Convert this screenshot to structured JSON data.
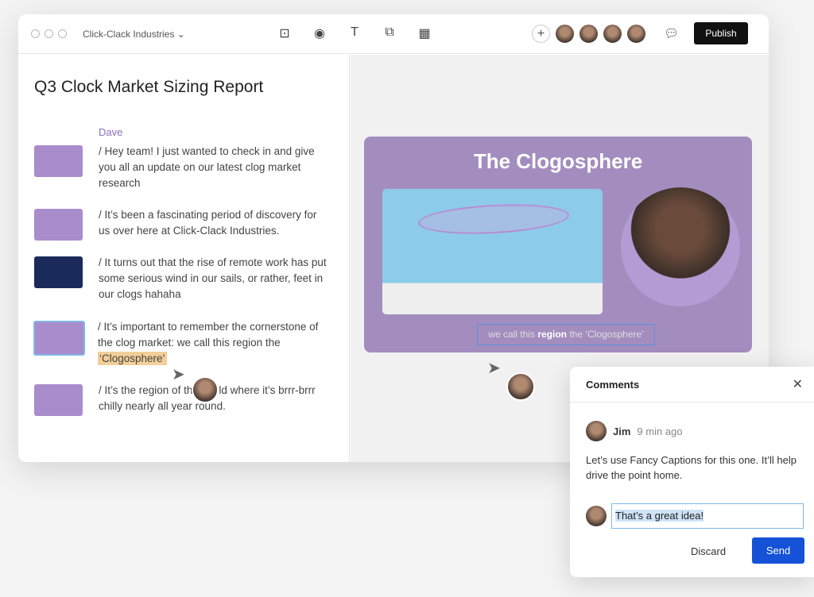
{
  "header": {
    "workspace": "Click-Clack Industries",
    "publish_label": "Publish",
    "add_label": "+"
  },
  "toolbar": {
    "icons": [
      "scene-icon",
      "record-icon",
      "text-icon",
      "shapes-icon",
      "grid-icon"
    ]
  },
  "doc": {
    "title": "Q3 Clock Market Sizing Report",
    "speaker": "Dave",
    "paragraphs": [
      "/ Hey team! I just wanted to check in and give you all an update on our latest clog market research",
      "/ It’s been a fascinating period of discovery for us over here at Click-Clack Industries.",
      "/ It turns out that the rise of remote work has put some serious wind in our sails, or rather, feet in our clogs hahaha",
      "/ It’s important to remember the cornerstone of the clog market: we call this region the ",
      "/ It’s the region of the world where it’s brrr-brrr chilly nearly all year round."
    ],
    "highlight": "‘Clogosphere’"
  },
  "slide": {
    "title": "The Clogosphere",
    "caption_pre": "we call this ",
    "caption_bold": "region",
    "caption_post": " the ‘Clogosphere’",
    "bg": "#a38dbf"
  },
  "comments": {
    "title": "Comments",
    "author": "Jim",
    "time": "9 min ago",
    "body": "Let’s use Fancy Captions for this one. It’ll help drive the point home.",
    "reply_value": "That’s a great idea!",
    "discard_label": "Discard",
    "send_label": "Send"
  }
}
